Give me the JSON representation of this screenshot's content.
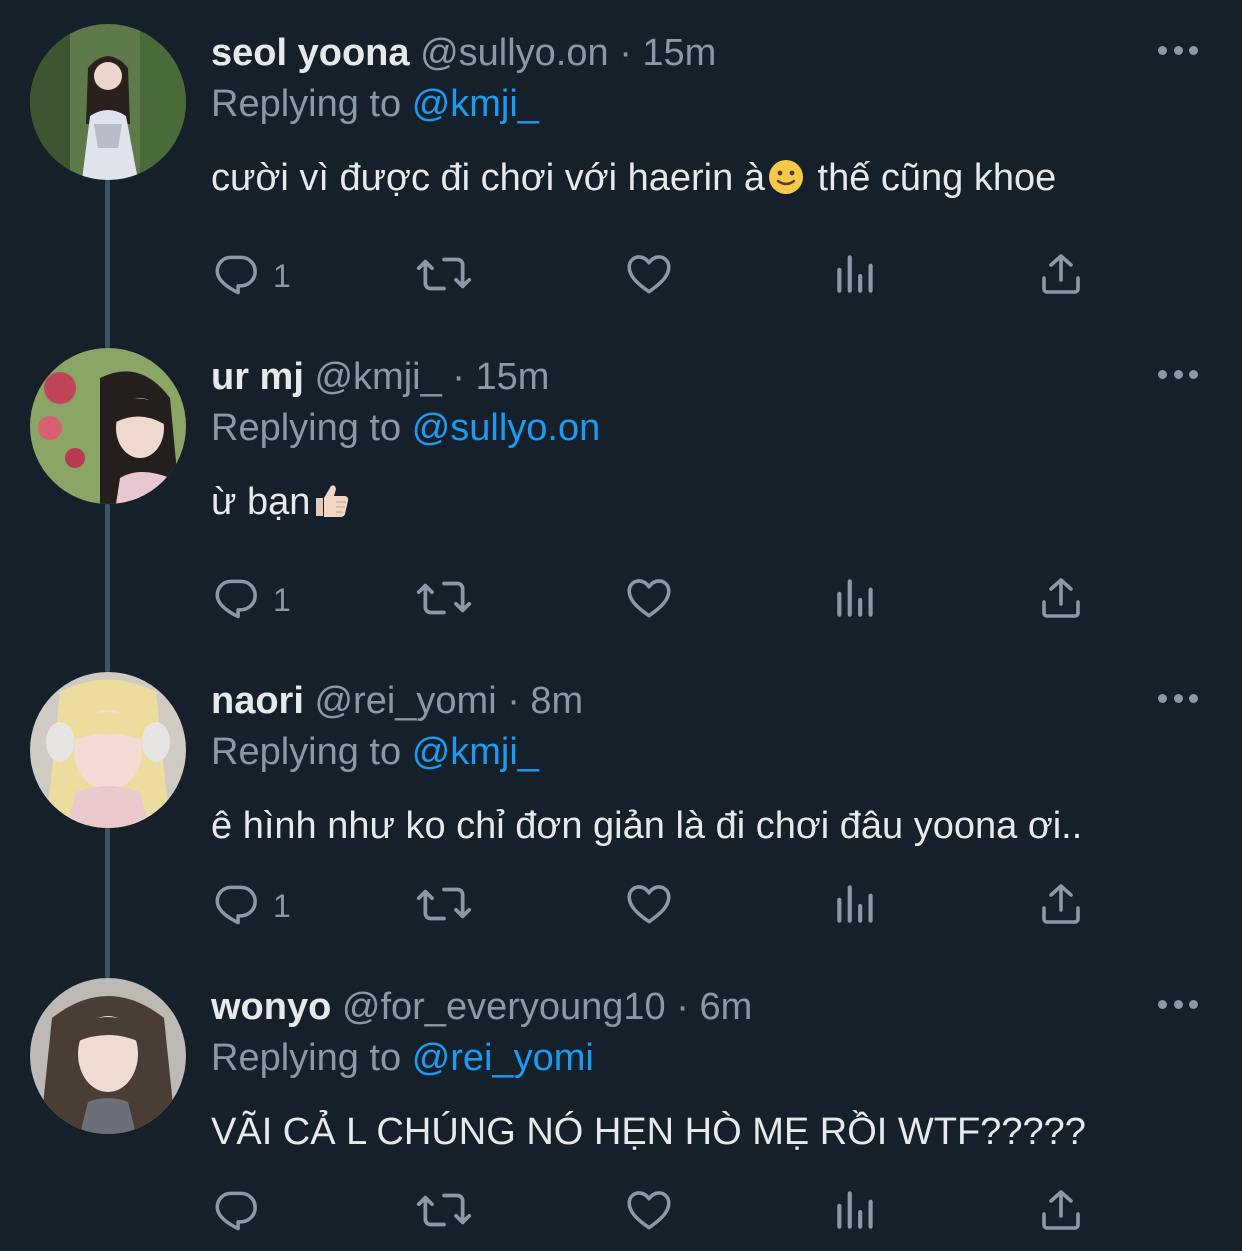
{
  "tweets": [
    {
      "name": "seol yoona",
      "handle": "@sullyo.on",
      "time": "15m",
      "reply_prefix": "Replying to",
      "reply_to": "@kmji_",
      "text": "cười vì được đi chơi với haerin à",
      "emoji": "slightly-smiling-face",
      "text_after": " thế cũng khoe",
      "reply_count": "1",
      "avatar_colors": [
        "#5f7a4a",
        "#2f4a2a",
        "#d9dde6"
      ]
    },
    {
      "name": "ur mj",
      "handle": "@kmji_",
      "time": "15m",
      "reply_prefix": "Replying to",
      "reply_to": "@sullyo.on",
      "text": "ừ bạn",
      "emoji": "thumbs-up",
      "text_after": "",
      "reply_count": "1",
      "avatar_colors": [
        "#a8c07a",
        "#2a2420",
        "#e8cfc4"
      ]
    },
    {
      "name": "naori",
      "handle": "@rei_yomi",
      "time": "8m",
      "reply_prefix": "Replying to",
      "reply_to": "@kmji_",
      "text": "ê hình như ko chỉ đơn giản là đi chơi đâu yoona ơi..",
      "emoji": "",
      "text_after": "",
      "reply_count": "1",
      "avatar_colors": [
        "#c9c6c0",
        "#e9d89a",
        "#efd6d2"
      ]
    },
    {
      "name": "wonyo",
      "handle": "@for_everyoung10",
      "time": "6m",
      "reply_prefix": "Replying to",
      "reply_to": "@rei_yomi",
      "text": "VÃI CẢ L CHÚNG NÓ HẸN HÒ MẸ RỒI WTF?????",
      "emoji": "",
      "text_after": "",
      "reply_count": "",
      "avatar_colors": [
        "#b9b6b2",
        "#4a3d36",
        "#ecd8d0"
      ]
    }
  ],
  "separator": "·",
  "icons": {
    "reply": "reply-icon",
    "retweet": "retweet-icon",
    "like": "like-icon",
    "views": "views-icon",
    "share": "share-icon",
    "more": "more-icon"
  },
  "colors": {
    "background": "#15202b",
    "text": "#e7e9ea",
    "muted": "#8b98a5",
    "link": "#1d9bf0",
    "thread_line": "#3d5466"
  }
}
